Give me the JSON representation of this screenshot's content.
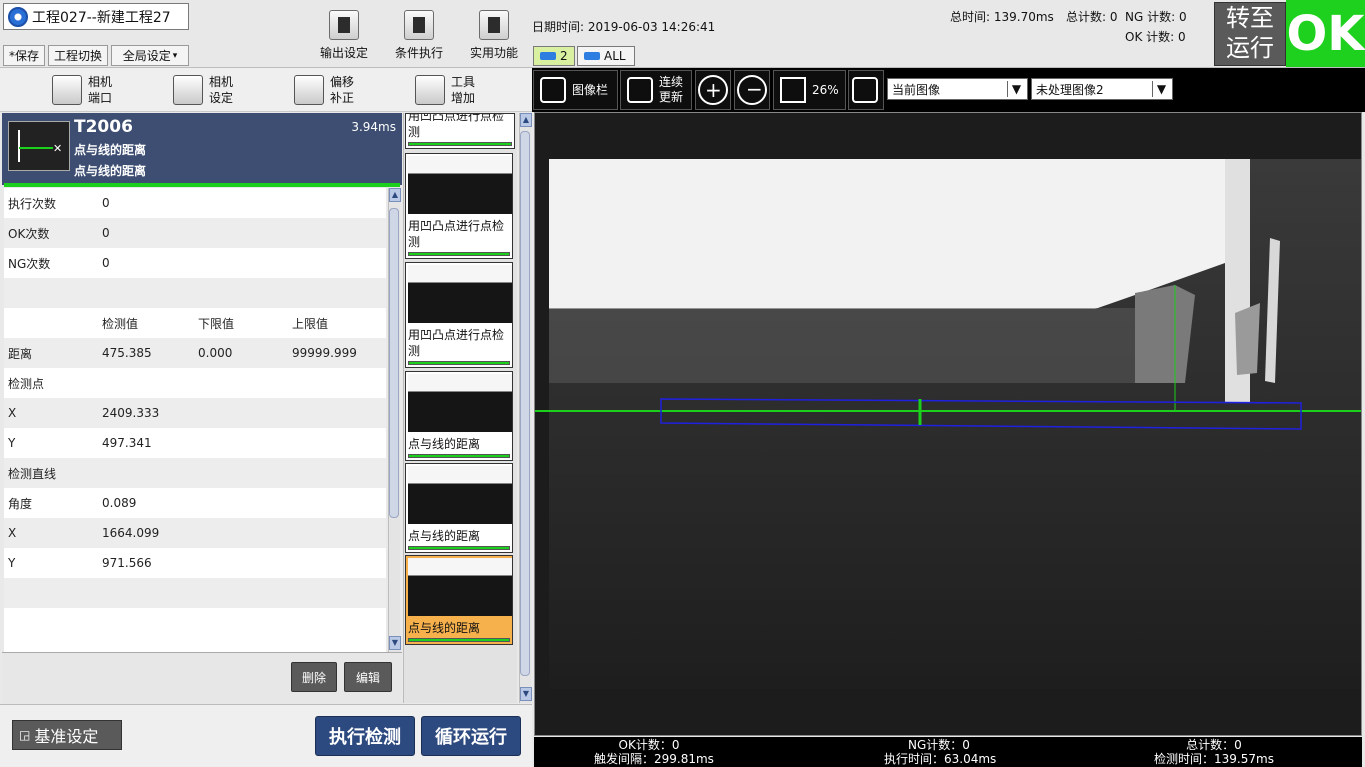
{
  "header": {
    "project_title": "工程027--新建工程27",
    "save_label": "*保存",
    "switch_label": "工程切换",
    "global_label": "全局设定",
    "tools": [
      {
        "label": "输出设定"
      },
      {
        "label": "条件执行"
      },
      {
        "label": "实用功能"
      }
    ],
    "datetime": "日期时间: 2019-06-03 14:26:41",
    "total_time": "总时间:  139.70ms",
    "total_count": "总计数: 0",
    "ng_count": "NG 计数: 0",
    "ok_count": "OK 计数: 0",
    "cam_tab_2": "2",
    "cam_tab_all": "ALL",
    "run_button": [
      "转至",
      "运行"
    ],
    "result": "OK",
    "result_color": "#1fd11f"
  },
  "left_toolbar": [
    {
      "line1": "相机",
      "line2": "端口"
    },
    {
      "line1": "相机",
      "line2": "设定"
    },
    {
      "line1": "偏移",
      "line2": "补正"
    },
    {
      "line1": "工具",
      "line2": "增加"
    }
  ],
  "tool": {
    "id": "T2006",
    "time": "3.94ms",
    "name1": "点与线的距离",
    "name2": "点与线的距离"
  },
  "table": {
    "rows": [
      [
        "执行次数",
        "0",
        "",
        ""
      ],
      [
        "OK次数",
        "0",
        "",
        ""
      ],
      [
        "NG次数",
        "0",
        "",
        ""
      ],
      [
        "",
        "",
        "",
        ""
      ],
      [
        "",
        "检测值",
        "下限值",
        "上限值"
      ],
      [
        "距离",
        "475.385",
        "0.000",
        "99999.999"
      ],
      [
        "检测点",
        "",
        "",
        ""
      ],
      [
        "X",
        "2409.333",
        "",
        ""
      ],
      [
        "Y",
        "497.341",
        "",
        ""
      ],
      [
        "检测直线",
        "",
        "",
        ""
      ],
      [
        "角度",
        "0.089",
        "",
        ""
      ],
      [
        "X",
        "1664.099",
        "",
        ""
      ],
      [
        "Y",
        "971.566",
        "",
        ""
      ],
      [
        "",
        "",
        "",
        ""
      ],
      [
        "",
        "",
        "",
        ""
      ]
    ]
  },
  "actions": {
    "delete": "删除",
    "edit": "编辑"
  },
  "tool_list": [
    {
      "label": "用凹凸点进行点检测"
    },
    {
      "label": "用凹凸点进行点检测"
    },
    {
      "label": "用凹凸点进行点检测"
    },
    {
      "label": "点与线的距离"
    },
    {
      "label": "点与线的距离"
    },
    {
      "label": "点与线的距离"
    }
  ],
  "bottom": {
    "baseline": "基准设定",
    "run_detect": "执行检测",
    "loop_run": "循环运行"
  },
  "image_toolbar": {
    "gallery": "图像栏",
    "continuous1": "连续",
    "continuous2": "更新",
    "zoom": "26%",
    "dropdown1": "当前图像",
    "dropdown2": "未处理图像2"
  },
  "stats": {
    "ok": "OK计数：0",
    "trigger": "触发间隔：299.81ms",
    "ng": "NG计数：0",
    "exec": "执行时间：63.04ms",
    "total": "总计数：0",
    "detect": "检测时间：139.57ms"
  }
}
